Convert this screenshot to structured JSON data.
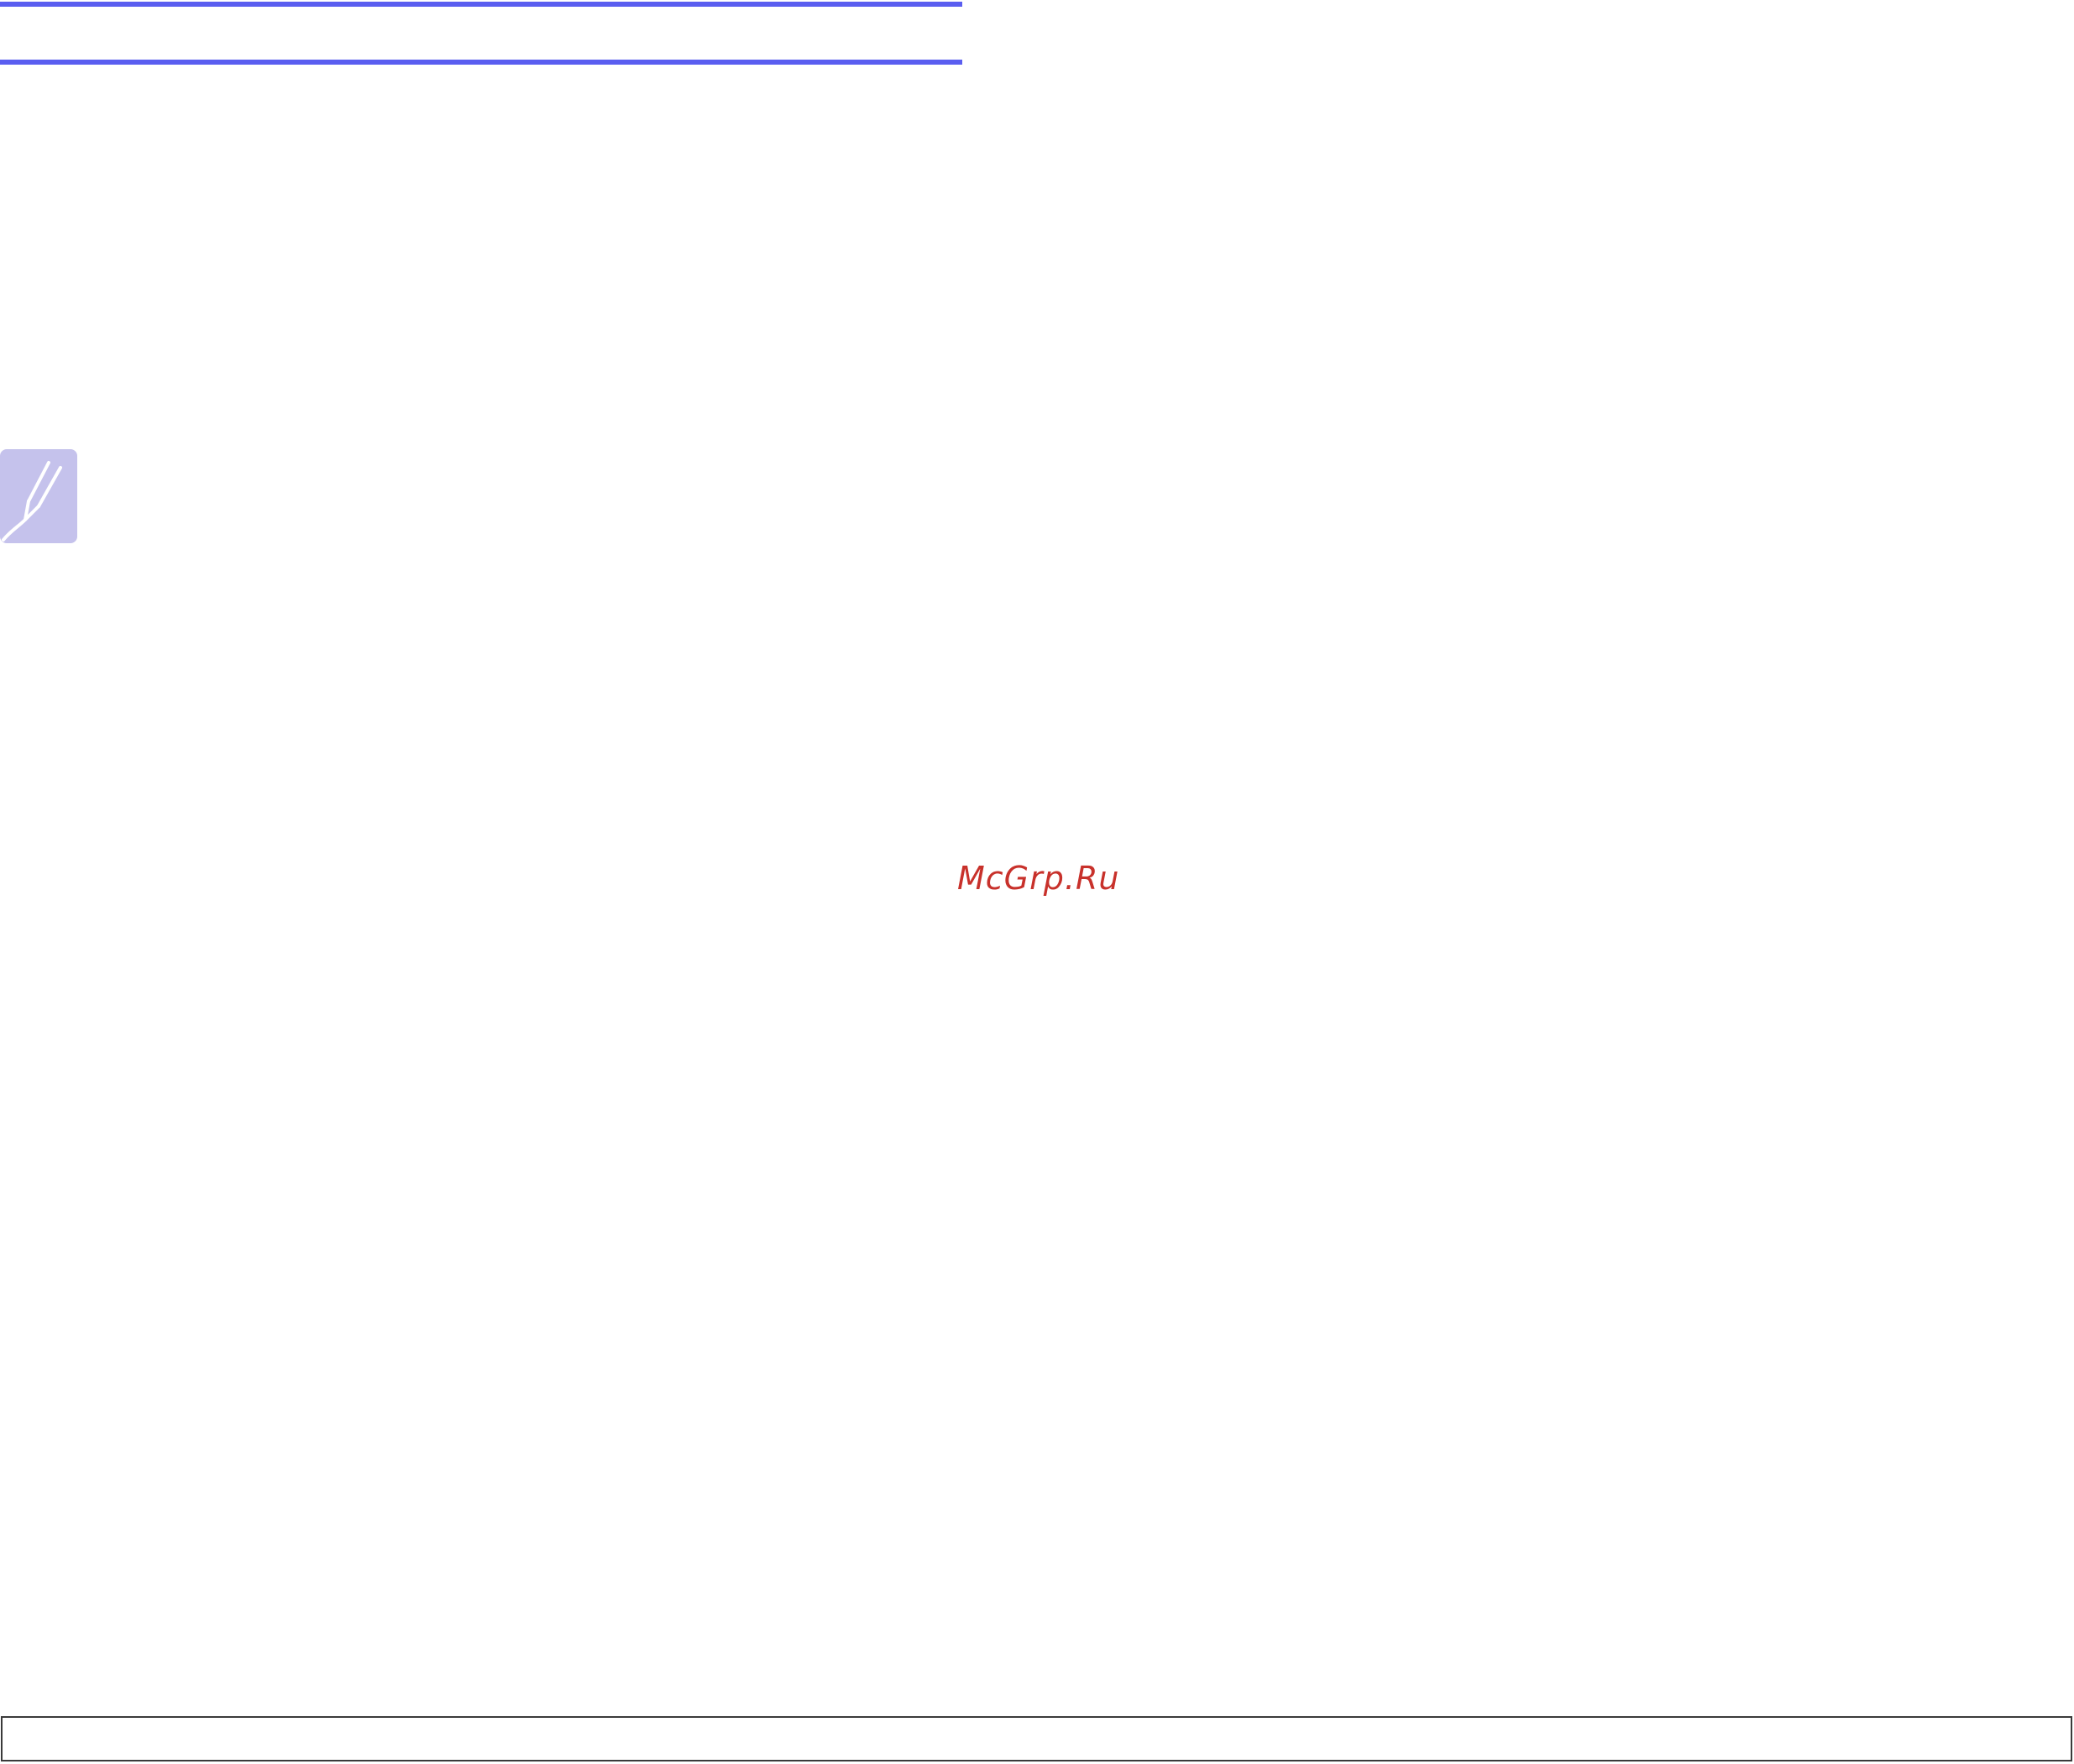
{
  "colors": {
    "rule": "#5a5ef0",
    "note_icon_bg": "#c5c2ec",
    "note_icon_mark": "#ffffff",
    "watermark": "#c8312b",
    "footer_border": "#3a3a3a"
  },
  "icons": {
    "note": "note-pencil-icon"
  },
  "watermark": {
    "text": "McGrp.Ru"
  }
}
